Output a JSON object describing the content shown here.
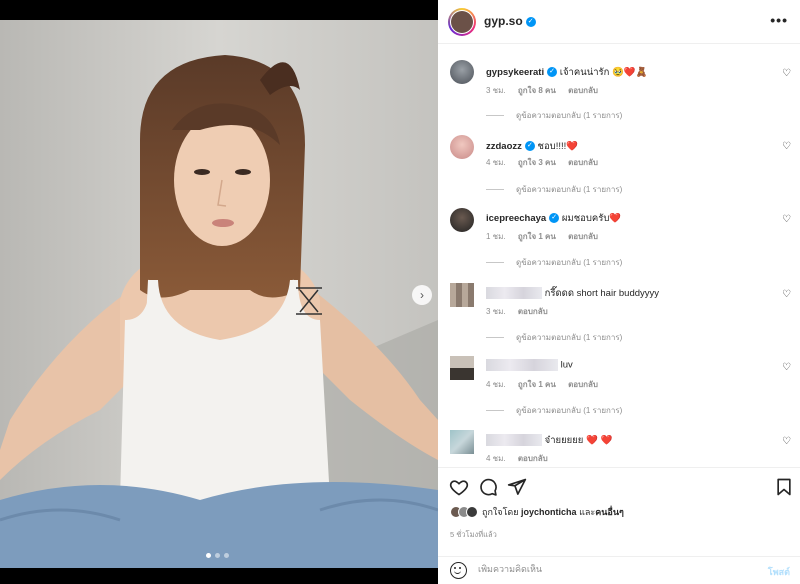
{
  "header": {
    "username": "gyp.so",
    "more_label": "•••"
  },
  "photo": {
    "carousel_dots": 3,
    "active_dot": 1
  },
  "comments": [
    {
      "user": "gypsykeerati",
      "verified": true,
      "text": "เจ้าคนน่ารัก 🥹❤️🧸",
      "time": "3 ชม.",
      "likes": "ถูกใจ 8 คน",
      "reply": "ตอบกลับ",
      "view_replies": "ดูข้อความตอบกลับ (1 รายการ)"
    },
    {
      "user": "zzdaozz",
      "verified": true,
      "text": "ชอบ!!!!❤️",
      "time": "4 ชม.",
      "likes": "ถูกใจ 3 คน",
      "reply": "ตอบกลับ",
      "view_replies": "ดูข้อความตอบกลับ (1 รายการ)"
    },
    {
      "user": "icepreechaya",
      "verified": true,
      "text": "ผมชอบครับ❤️",
      "time": "1 ชม.",
      "likes": "ถูกใจ 1 คน",
      "reply": "ตอบกลับ",
      "view_replies": "ดูข้อความตอบกลับ (1 รายการ)"
    },
    {
      "user": "",
      "verified": false,
      "text": "กรี๊ดดด short hair buddyyyy",
      "time": "3 ชม.",
      "likes": "",
      "reply": "ตอบกลับ",
      "view_replies": "ดูข้อความตอบกลับ (1 รายการ)"
    },
    {
      "user": "",
      "verified": false,
      "text": "luv",
      "time": "4 ชม.",
      "likes": "ถูกใจ 1 คน",
      "reply": "ตอบกลับ",
      "view_replies": "ดูข้อความตอบกลับ (1 รายการ)"
    },
    {
      "user": "",
      "verified": false,
      "text": "จ๋ายยยยย ❤️ ❤️",
      "time": "4 ชม.",
      "likes": "",
      "reply": "ตอบกลับ",
      "view_replies": ""
    }
  ],
  "liked_by": {
    "prefix": "ถูกใจโดย",
    "user": "joychonticha",
    "conj": "และ",
    "others": "คนอื่นๆ"
  },
  "post_time": "5 ชั่วโมงที่แล้ว",
  "comment_box": {
    "placeholder": "เพิ่มความคิดเห็น",
    "post_label": "โพสต์"
  },
  "colors": {
    "verified": "#0095f6",
    "post_button": "#b2dffc",
    "heart": "#ed4956"
  }
}
